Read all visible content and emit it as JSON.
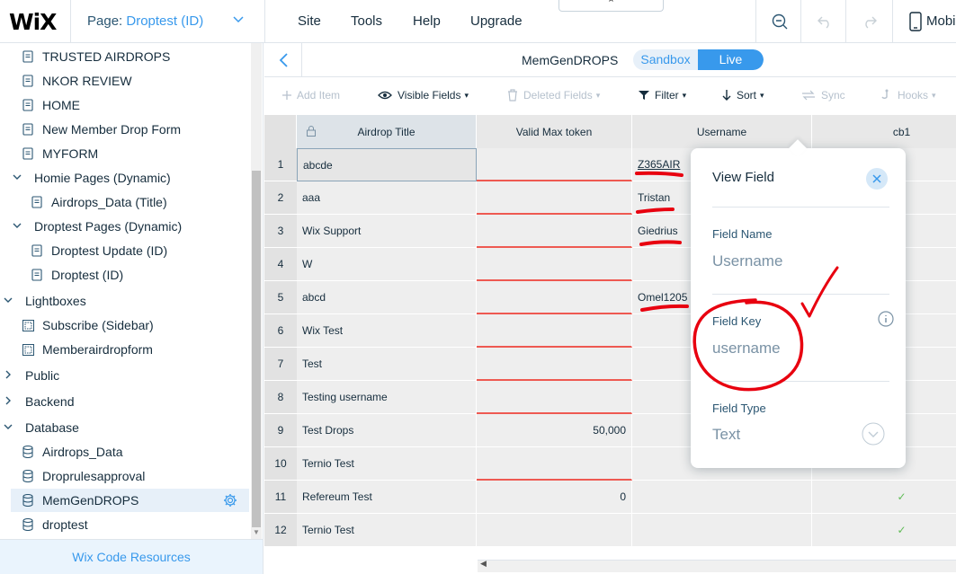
{
  "topbar": {
    "logo": "WiX",
    "page_prefix": "Page:",
    "page_value": "Droptest (ID)",
    "menu": [
      "Site",
      "Tools",
      "Help",
      "Upgrade"
    ],
    "collapse_glyph": "⌃",
    "mobile_label": "Mobi"
  },
  "sidebar": {
    "items": [
      {
        "label": "TRUSTED AIRDROPS",
        "icon": "page-icon"
      },
      {
        "label": "NKOR REVIEW",
        "icon": "page-icon"
      },
      {
        "label": "HOME",
        "icon": "page-icon"
      },
      {
        "label": "New Member Drop Form",
        "icon": "page-icon"
      },
      {
        "label": "MYFORM",
        "icon": "page-icon"
      },
      {
        "label": "Homie Pages (Dynamic)",
        "icon": "chevron-down-icon"
      },
      {
        "label": "Airdrops_Data (Title)",
        "icon": "page-icon"
      },
      {
        "label": "Droptest Pages (Dynamic)",
        "icon": "chevron-down-icon"
      },
      {
        "label": "Droptest Update (ID)",
        "icon": "page-icon"
      },
      {
        "label": "Droptest (ID)",
        "icon": "page-icon"
      },
      {
        "label": "Lightboxes",
        "icon": "chevron-down-icon"
      },
      {
        "label": "Subscribe (Sidebar)",
        "icon": "lightbox-icon"
      },
      {
        "label": "Memberairdropform",
        "icon": "lightbox-icon"
      },
      {
        "label": "Public",
        "icon": "chevron-right-icon"
      },
      {
        "label": "Backend",
        "icon": "chevron-right-icon"
      },
      {
        "label": "Database",
        "icon": "chevron-down-icon"
      },
      {
        "label": "Airdrops_Data",
        "icon": "database-icon"
      },
      {
        "label": "Droprulesapproval",
        "icon": "database-icon"
      },
      {
        "label": "MemGenDROPS",
        "icon": "database-icon"
      },
      {
        "label": "droptest",
        "icon": "database-icon"
      }
    ],
    "footer": "Wix Code Resources"
  },
  "collection": {
    "name": "MemGenDROPS",
    "sandbox_label": "Sandbox",
    "live_label": "Live"
  },
  "toolbar": {
    "add_item": "Add Item",
    "visible_fields": "Visible Fields",
    "deleted_fields": "Deleted Fields",
    "filter": "Filter",
    "sort": "Sort",
    "sync": "Sync",
    "hooks": "Hooks"
  },
  "table": {
    "columns": [
      "Airdrop Title",
      "Valid Max token",
      "Username",
      "cb1"
    ],
    "rows": [
      {
        "n": "1",
        "title": "abcde",
        "token": "",
        "user": "Z365AIR",
        "cb": ""
      },
      {
        "n": "2",
        "title": "aaa",
        "token": "",
        "user": "Tristan",
        "cb": ""
      },
      {
        "n": "3",
        "title": "Wix Support",
        "token": "",
        "user": "Giedrius",
        "cb": ""
      },
      {
        "n": "4",
        "title": "W",
        "token": "",
        "user": "",
        "cb": ""
      },
      {
        "n": "5",
        "title": "abcd",
        "token": "",
        "user": "Omel1205",
        "cb": ""
      },
      {
        "n": "6",
        "title": "Wix Test",
        "token": "",
        "user": "",
        "cb": ""
      },
      {
        "n": "7",
        "title": "Test",
        "token": "",
        "user": "",
        "cb": ""
      },
      {
        "n": "8",
        "title": "Testing username",
        "token": "",
        "user": "",
        "cb": ""
      },
      {
        "n": "9",
        "title": "Test Drops",
        "token": "50,000",
        "user": "",
        "cb": ""
      },
      {
        "n": "10",
        "title": "Ternio Test",
        "token": "",
        "user": "",
        "cb": ""
      },
      {
        "n": "11",
        "title": "Refereum Test",
        "token": "0",
        "user": "",
        "cb": "✓"
      },
      {
        "n": "12",
        "title": "Ternio Test",
        "token": "",
        "user": "",
        "cb": "✓"
      }
    ]
  },
  "popup": {
    "title": "View Field",
    "field_name_label": "Field Name",
    "field_name_value": "Username",
    "field_key_label": "Field Key",
    "field_key_value": "username",
    "field_type_label": "Field Type",
    "field_type_value": "Text"
  },
  "colors": {
    "accent": "#3899ec",
    "annotation": "#e8000f",
    "error_underline": "#ee5951",
    "check": "#60bc57"
  }
}
